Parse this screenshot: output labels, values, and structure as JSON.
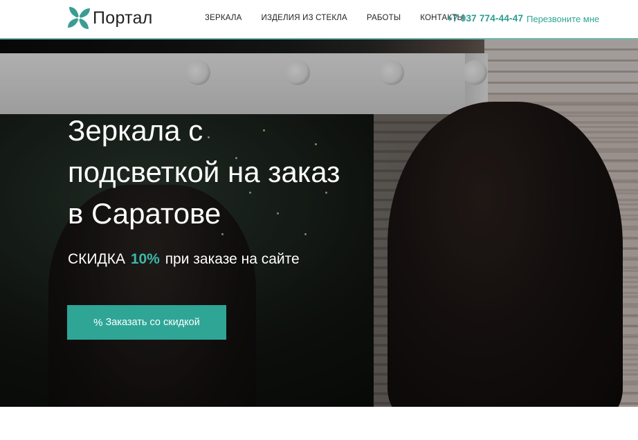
{
  "header": {
    "logo_text": "Портал",
    "nav": [
      "ЗЕРКАЛА",
      "ИЗДЕЛИЯ ИЗ СТЕКЛА",
      "РАБОТЫ",
      "КОНТАКТЫ"
    ],
    "phone": "+7 937 774-44-47",
    "callback_label": "Перезвоните мне"
  },
  "hero": {
    "title_lines": [
      "Зеркала с",
      "подсветкой на заказ",
      "в Саратове"
    ],
    "discount_prefix": "СКИДКА",
    "discount_value": "10%",
    "discount_suffix": "при заказе на сайте",
    "cta_label": "Заказать со скидкой",
    "cta_icon": "percent-icon"
  },
  "colors": {
    "accent": "#2fa596",
    "accent_light": "#3cb8a8",
    "logo_teal": "#3a9d93"
  }
}
